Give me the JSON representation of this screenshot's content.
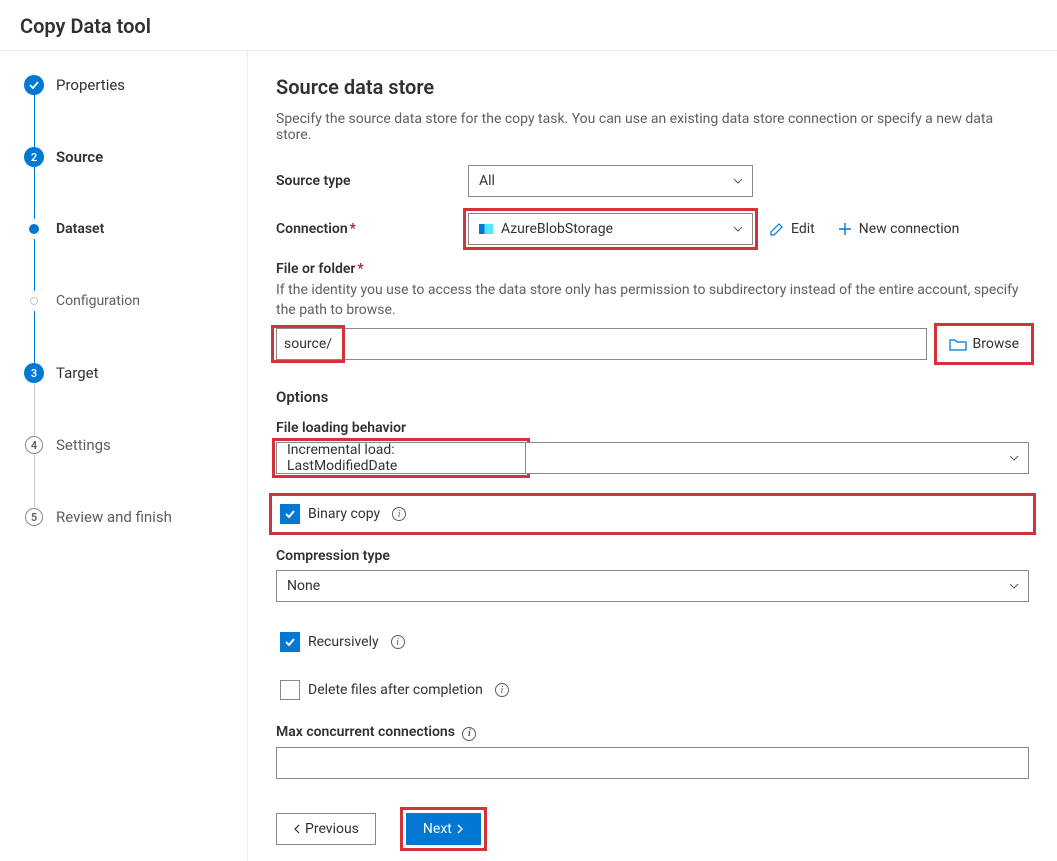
{
  "header": {
    "title": "Copy Data tool"
  },
  "sidebar": {
    "steps": [
      {
        "label": "Properties"
      },
      {
        "label": "Source"
      },
      {
        "label": "Dataset"
      },
      {
        "label": "Configuration"
      },
      {
        "label": "Target"
      },
      {
        "label": "Settings"
      },
      {
        "label": "Review and finish"
      }
    ]
  },
  "main": {
    "title": "Source data store",
    "description": "Specify the source data store for the copy task. You can use an existing data store connection or specify a new data store.",
    "source_type_label": "Source type",
    "source_type_value": "All",
    "connection_label": "Connection",
    "connection_value": "AzureBlobStorage",
    "edit_label": "Edit",
    "new_connection_label": "New connection",
    "file_folder_label": "File or folder",
    "file_folder_hint": "If the identity you use to access the data store only has permission to subdirectory instead of the entire account, specify the path to browse.",
    "file_folder_value": "source/",
    "browse_label": "Browse",
    "options_label": "Options",
    "file_loading_label": "File loading behavior",
    "file_loading_value": "Incremental load: LastModifiedDate",
    "binary_copy_label": "Binary copy",
    "compression_label": "Compression type",
    "compression_value": "None",
    "recursively_label": "Recursively",
    "delete_after_label": "Delete files after completion",
    "max_conn_label": "Max concurrent connections",
    "prev_label": "Previous",
    "next_label": "Next"
  }
}
